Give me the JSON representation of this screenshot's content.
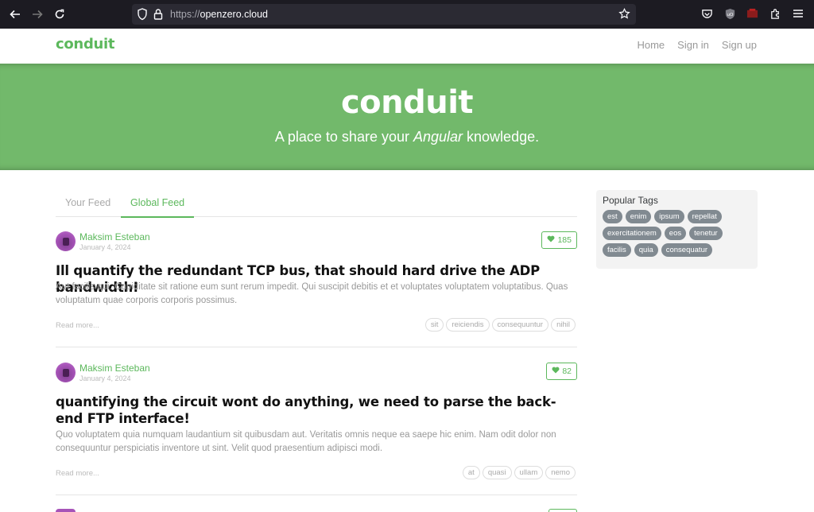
{
  "browser": {
    "url_scheme": "https://",
    "url_host": "openzero.cloud"
  },
  "navbar": {
    "brand": "conduit",
    "links": [
      "Home",
      "Sign in",
      "Sign up"
    ]
  },
  "banner": {
    "title": "conduit",
    "tagline_pre": "A place to share your ",
    "tagline_em": "Angular",
    "tagline_post": " knowledge."
  },
  "feed": {
    "tabs": [
      "Your Feed",
      "Global Feed"
    ],
    "active_tab": "Global Feed",
    "articles": [
      {
        "author": "Maksim Esteban",
        "date": "January 4, 2024",
        "likes": "185",
        "title": "Ill quantify the redundant TCP bus, that should hard drive the ADP bandwidth!",
        "description": "Aut facilis qui. Cupiditate sit ratione eum sunt rerum impedit. Qui suscipit debitis et et voluptates voluptatem voluptatibus. Quas voluptatum quae corporis corporis possimus.",
        "read_more": "Read more...",
        "tags": [
          "sit",
          "reiciendis",
          "consequuntur",
          "nihil"
        ]
      },
      {
        "author": "Maksim Esteban",
        "date": "January 4, 2024",
        "likes": "82",
        "title": "quantifying the circuit wont do anything, we need to parse the back-end FTP interface!",
        "description": "Quo voluptatem quia numquam laudantium sit quibusdam aut. Veritatis omnis neque ea saepe hic enim. Nam odit dolor non consequuntur perspiciatis inventore ut sint. Velit quod praesentium adipisci modi.",
        "read_more": "Read more...",
        "tags": [
          "at",
          "quasi",
          "ullam",
          "nemo"
        ]
      }
    ]
  },
  "sidebar": {
    "title": "Popular Tags",
    "tags": [
      "est",
      "enim",
      "ipsum",
      "repellat",
      "exercitationem",
      "eos",
      "tenetur",
      "facilis",
      "quia",
      "consequatur"
    ]
  },
  "colors": {
    "accent": "#5cb85c",
    "banner": "#72b96b",
    "tag_pill": "#818a91"
  }
}
